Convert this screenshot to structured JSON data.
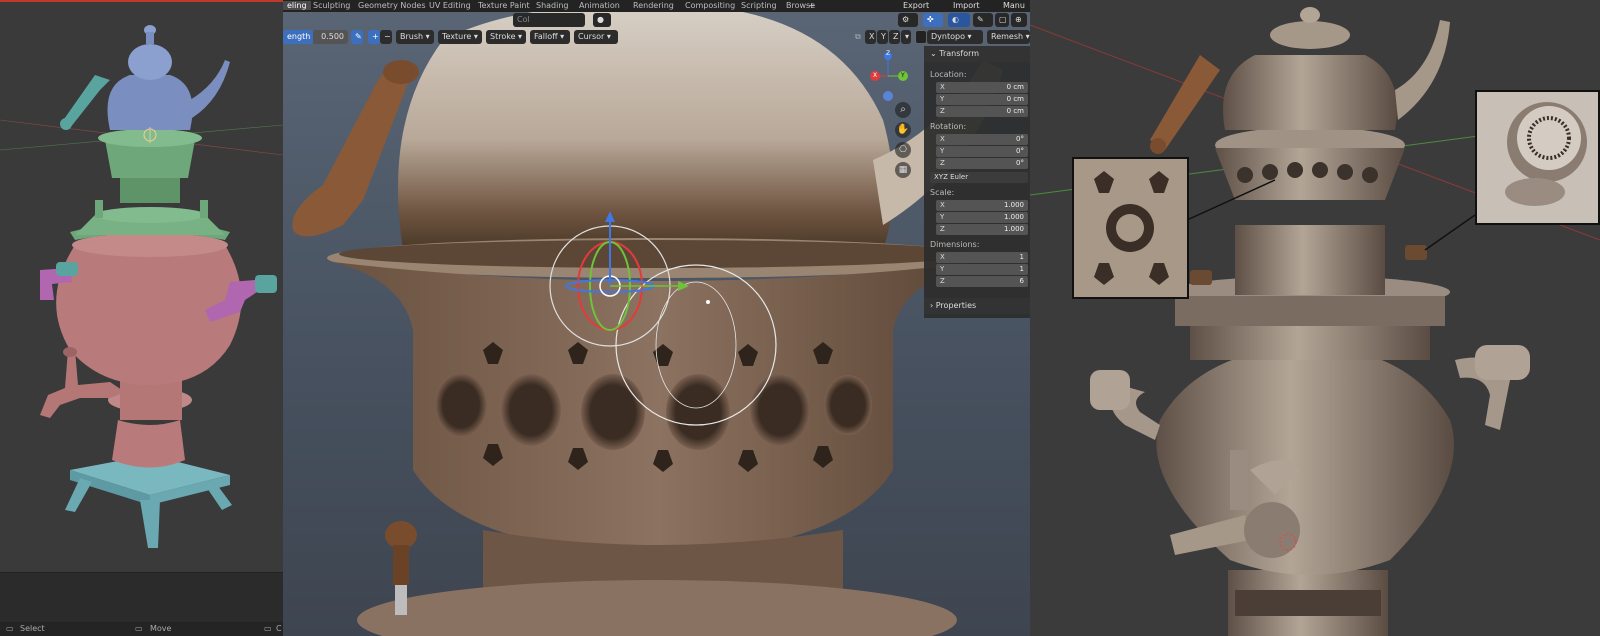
{
  "menubar": {
    "tabs": [
      "eling",
      "Sculpting",
      "Geometry Nodes",
      "UV Editing",
      "Texture Paint",
      "Shading",
      "Animation",
      "Rendering",
      "Compositing",
      "Scripting",
      "Browse",
      "+"
    ],
    "active_tab": "eling",
    "right_menu": [
      "Export",
      "Import",
      "Manu"
    ],
    "search_field": "Col"
  },
  "toolbar": {
    "strength_label": "ength",
    "strength_value": "0.500",
    "plus": "+",
    "minus": "−",
    "dropdowns": [
      "Brush",
      "Texture",
      "Stroke",
      "Falloff",
      "Cursor"
    ],
    "axes": [
      "X",
      "Y",
      "Z"
    ],
    "dyntopo": "Dyntopo",
    "remesh": "Remesh"
  },
  "gizmo": {
    "x": "X",
    "y": "Y",
    "z": "Z"
  },
  "transform_panel": {
    "title": "Transform",
    "location_label": "Location:",
    "location": [
      {
        "axis": "X",
        "value": "0 cm"
      },
      {
        "axis": "Y",
        "value": "0 cm"
      },
      {
        "axis": "Z",
        "value": "0 cm"
      }
    ],
    "rotation_label": "Rotation:",
    "rotation": [
      {
        "axis": "X",
        "value": "0°"
      },
      {
        "axis": "Y",
        "value": "0°"
      },
      {
        "axis": "Z",
        "value": "0°"
      }
    ],
    "rotation_mode": "XYZ Euler",
    "scale_label": "Scale:",
    "scale": [
      {
        "axis": "X",
        "value": "1.000"
      },
      {
        "axis": "Y",
        "value": "1.000"
      },
      {
        "axis": "Z",
        "value": "1.000"
      }
    ],
    "dimensions_label": "Dimensions:",
    "dimensions": [
      {
        "axis": "X",
        "value": "1"
      },
      {
        "axis": "Y",
        "value": "1"
      },
      {
        "axis": "Z",
        "value": "6"
      }
    ],
    "properties_label": "Properties"
  },
  "statusbar": {
    "items": [
      "Select",
      "Move",
      "C"
    ]
  },
  "colors": {
    "teapot_blue": "#7a8fbf",
    "ring_green": "#6ea77a",
    "body_pink": "#b87a7a",
    "handle_magenta": "#b067b0",
    "base_cyan": "#7ab8c0",
    "metal": "#8a7664",
    "accent_blue": "#3d6fbf"
  },
  "icons": [
    "zoom-icon",
    "hand-icon",
    "camera-icon",
    "grid-icon",
    "dropdown-chevron-icon"
  ]
}
